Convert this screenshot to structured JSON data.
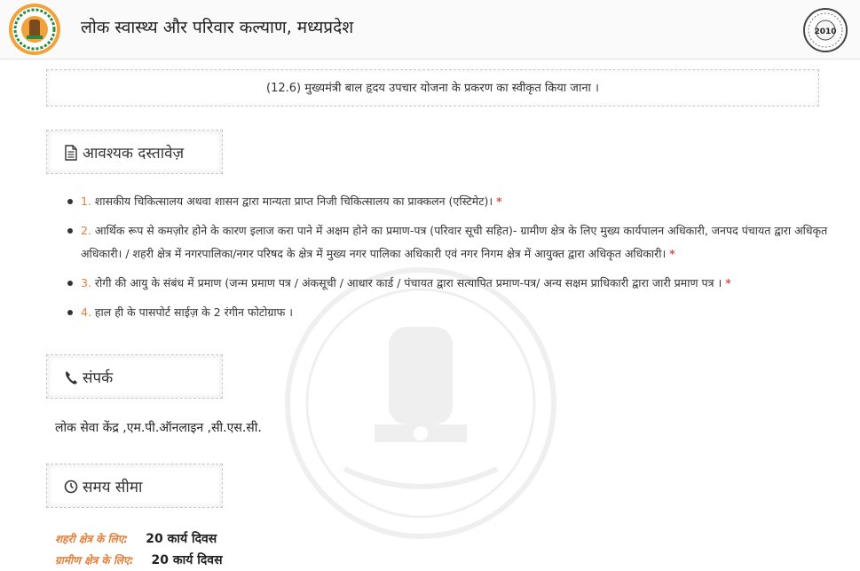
{
  "header": {
    "title": "लोक स्वास्थ्य और परिवार कल्याण, मध्यप्रदेश",
    "seal_year": "2010",
    "logo_icon": "mp-govt-emblem-icon",
    "seal_icon": "public-service-guarantee-seal-icon"
  },
  "scheme": {
    "title": "(12.6) मुख्यमंत्री बाल हृदय उपचार योजना के प्रकरण का स्वीकृत किया जाना ।"
  },
  "documents": {
    "heading": "आवश्यक दस्तावेज़",
    "icon": "document-icon",
    "items": [
      {
        "num": "1.",
        "text": " शासकीय चिकित्सालय अथवा शासन द्वारा मान्यता प्राप्त निजी चिकित्सालय का प्राक्कलन (एस्टिमेट)। ",
        "required": "*"
      },
      {
        "num": "2.",
        "text": " आर्थिक रूप से कमज़ोर होने के कारण इलाज करा पाने में अक्षम होने का प्रमाण-पत्र (परिवार सूची सहित)- ग्रामीण क्षेत्र के लिए मुख्य कार्यपालन अधिकारी, जनपद पंचायत द्वारा अधिकृत अधिकारी। / शहरी क्षेत्र में नगरपालिका/नगर परिषद के क्षेत्र में मुख्य नगर पालिका अधिकारी एवं नगर निगम क्षेत्र में आयुक्त द्वारा अधिकृत अधिकारी। ",
        "required": "*"
      },
      {
        "num": "3.",
        "text": " रोगी की आयु के संबंध में प्रमाण (जन्म प्रमाण पत्र / अंकसूची / आधार कार्ड / पंचायत द्वारा सत्यापित प्रमाण-पत्र/ अन्य सक्षम प्राधिकारी द्वारा जारी प्रमाण पत्र । ",
        "required": "*"
      },
      {
        "num": "4.",
        "text": " हाल ही के पासपोर्ट साईज़ के 2 रंगीन फोटोग्राफ ।",
        "required": ""
      }
    ]
  },
  "contact": {
    "heading": "संपर्क",
    "icon": "phone-icon",
    "text": "लोक सेवा केंद्र ,एम.पी.ऑनलाइन ,सी.एस.सी."
  },
  "timeline": {
    "heading": "समय सीमा",
    "icon": "clock-icon",
    "urban_label": "शहरी क्षेत्र के लिए:",
    "urban_value": "20 कार्य दिवस",
    "rural_label": "ग्रामीण क्षेत्र के लिए:",
    "rural_value": "20 कार्य दिवस"
  },
  "colors": {
    "accent_orange": "#e67e3c",
    "required_red": "#d9534f",
    "header_bg": "#fafafa"
  }
}
